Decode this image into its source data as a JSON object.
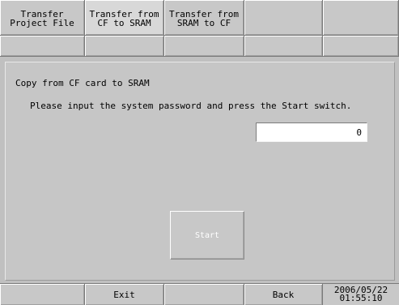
{
  "tabs_row1": [
    {
      "label": "Transfer\nProject File",
      "active": false
    },
    {
      "label": "Transfer from\nCF to SRAM",
      "active": true
    },
    {
      "label": "Transfer from\nSRAM to CF",
      "active": false
    },
    {
      "label": "",
      "active": false
    },
    {
      "label": "",
      "active": false
    }
  ],
  "panel": {
    "heading": "Copy from CF card to SRAM",
    "instruction": "Please input the system password and press the Start switch.",
    "password_value": "0",
    "start_label": "Start"
  },
  "bottom": {
    "exit_label": "Exit",
    "back_label": "Back",
    "date": "2006/05/22",
    "time": "01:55:10"
  },
  "colors": {
    "background": "#c0c0c0",
    "field": "#ffffff",
    "disabled_text": "#ffffff"
  }
}
